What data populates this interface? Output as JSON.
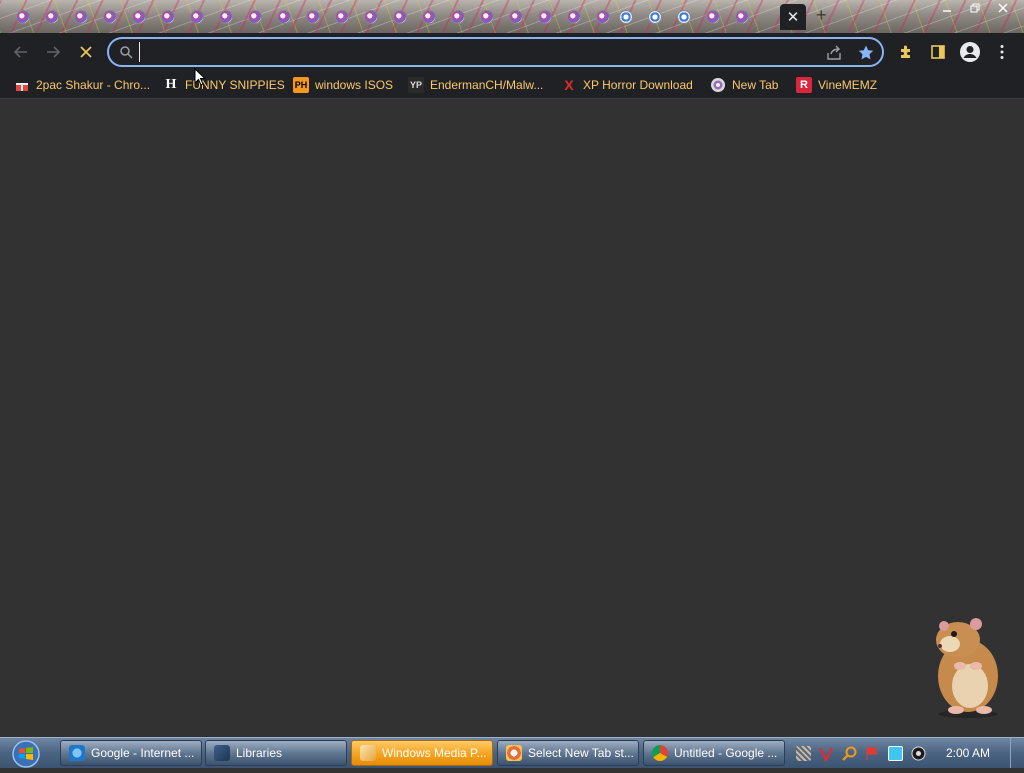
{
  "browser": {
    "omnibox": {
      "value": "",
      "placeholder": ""
    },
    "tab_close_glyph": "✕",
    "new_tab_glyph": "+",
    "bookmarks": [
      {
        "label": "2pac Shakur - Chro...",
        "icon": "gift-icon",
        "color": "#e8453c"
      },
      {
        "label": "FUNNY SNIPPIES",
        "icon": "h-icon",
        "color": "#ffffff"
      },
      {
        "label": "windows ISOS",
        "icon": "ph-icon",
        "color": "#f7971d"
      },
      {
        "label": "EndermanCH/Malw...",
        "icon": "yp-icon",
        "color": "#2b2b2b"
      },
      {
        "label": "XP Horror Download",
        "icon": "x-icon",
        "color": "#e32b2b"
      },
      {
        "label": "New Tab",
        "icon": "globe-icon",
        "color": "#9b6bb8"
      },
      {
        "label": "VineMEMZ",
        "icon": "r-icon",
        "color": "#d7263d"
      }
    ],
    "bookmark_icon_text": {
      "h": "H",
      "ph": "PH",
      "yp": "YP",
      "x": "X",
      "r": "R"
    }
  },
  "taskbar": {
    "buttons": [
      {
        "label": "Google - Internet ...",
        "icon": "ie-icon"
      },
      {
        "label": "Libraries",
        "icon": "explorer-icon"
      },
      {
        "label": "Windows Media P...",
        "icon": "media-player-icon"
      },
      {
        "label": "Select New Tab st...",
        "icon": "paint-icon"
      },
      {
        "label": "Untitled - Google ...",
        "icon": "chrome-icon"
      }
    ],
    "clock": "2:00 AM"
  },
  "colors": {
    "accent": "#8ab4f8",
    "bookmark_text": "#f9c96a",
    "page_bg": "#323232",
    "toolbar_bg": "#202124"
  }
}
